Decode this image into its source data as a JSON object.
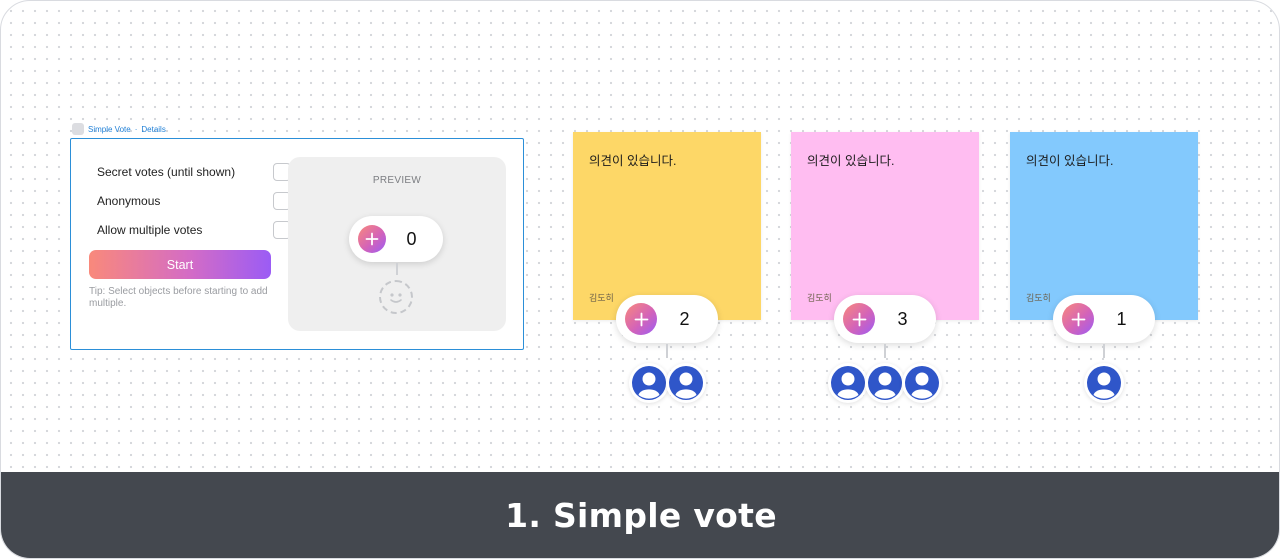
{
  "plugin": {
    "header_title": "Simple Vote",
    "header_sep": "·",
    "header_link": "Details",
    "options": [
      {
        "label": "Secret votes (until shown)",
        "checked": false
      },
      {
        "label": "Anonymous",
        "checked": false
      },
      {
        "label": "Allow multiple votes",
        "checked": false
      }
    ],
    "start_label": "Start",
    "tip": "Tip: Select objects before starting to add multiple.",
    "preview_title": "PREVIEW",
    "preview_count": "0"
  },
  "stickies": [
    {
      "text": "의견이 있습니다.",
      "author": "김도히",
      "color": "#fdd767",
      "votes": "2",
      "voters": 2
    },
    {
      "text": "의견이 있습니다.",
      "author": "김도히",
      "color": "#ffbdf1",
      "votes": "3",
      "voters": 3
    },
    {
      "text": "의견이 있습니다.",
      "author": "김도히",
      "color": "#83c9fd",
      "votes": "1",
      "voters": 1
    }
  ],
  "icons": {
    "vote_button": "plus-icon",
    "voter": "user-avatar-icon",
    "placeholder": "placeholder-avatar-icon"
  },
  "colors": {
    "accent_gradient": [
      "#f9897b",
      "#d463b8",
      "#9b5cf5"
    ],
    "selection": "#2b8fd8",
    "avatar": "#2f56c9",
    "footer": "#44484f"
  },
  "footer": {
    "title": "1. Simple vote"
  }
}
